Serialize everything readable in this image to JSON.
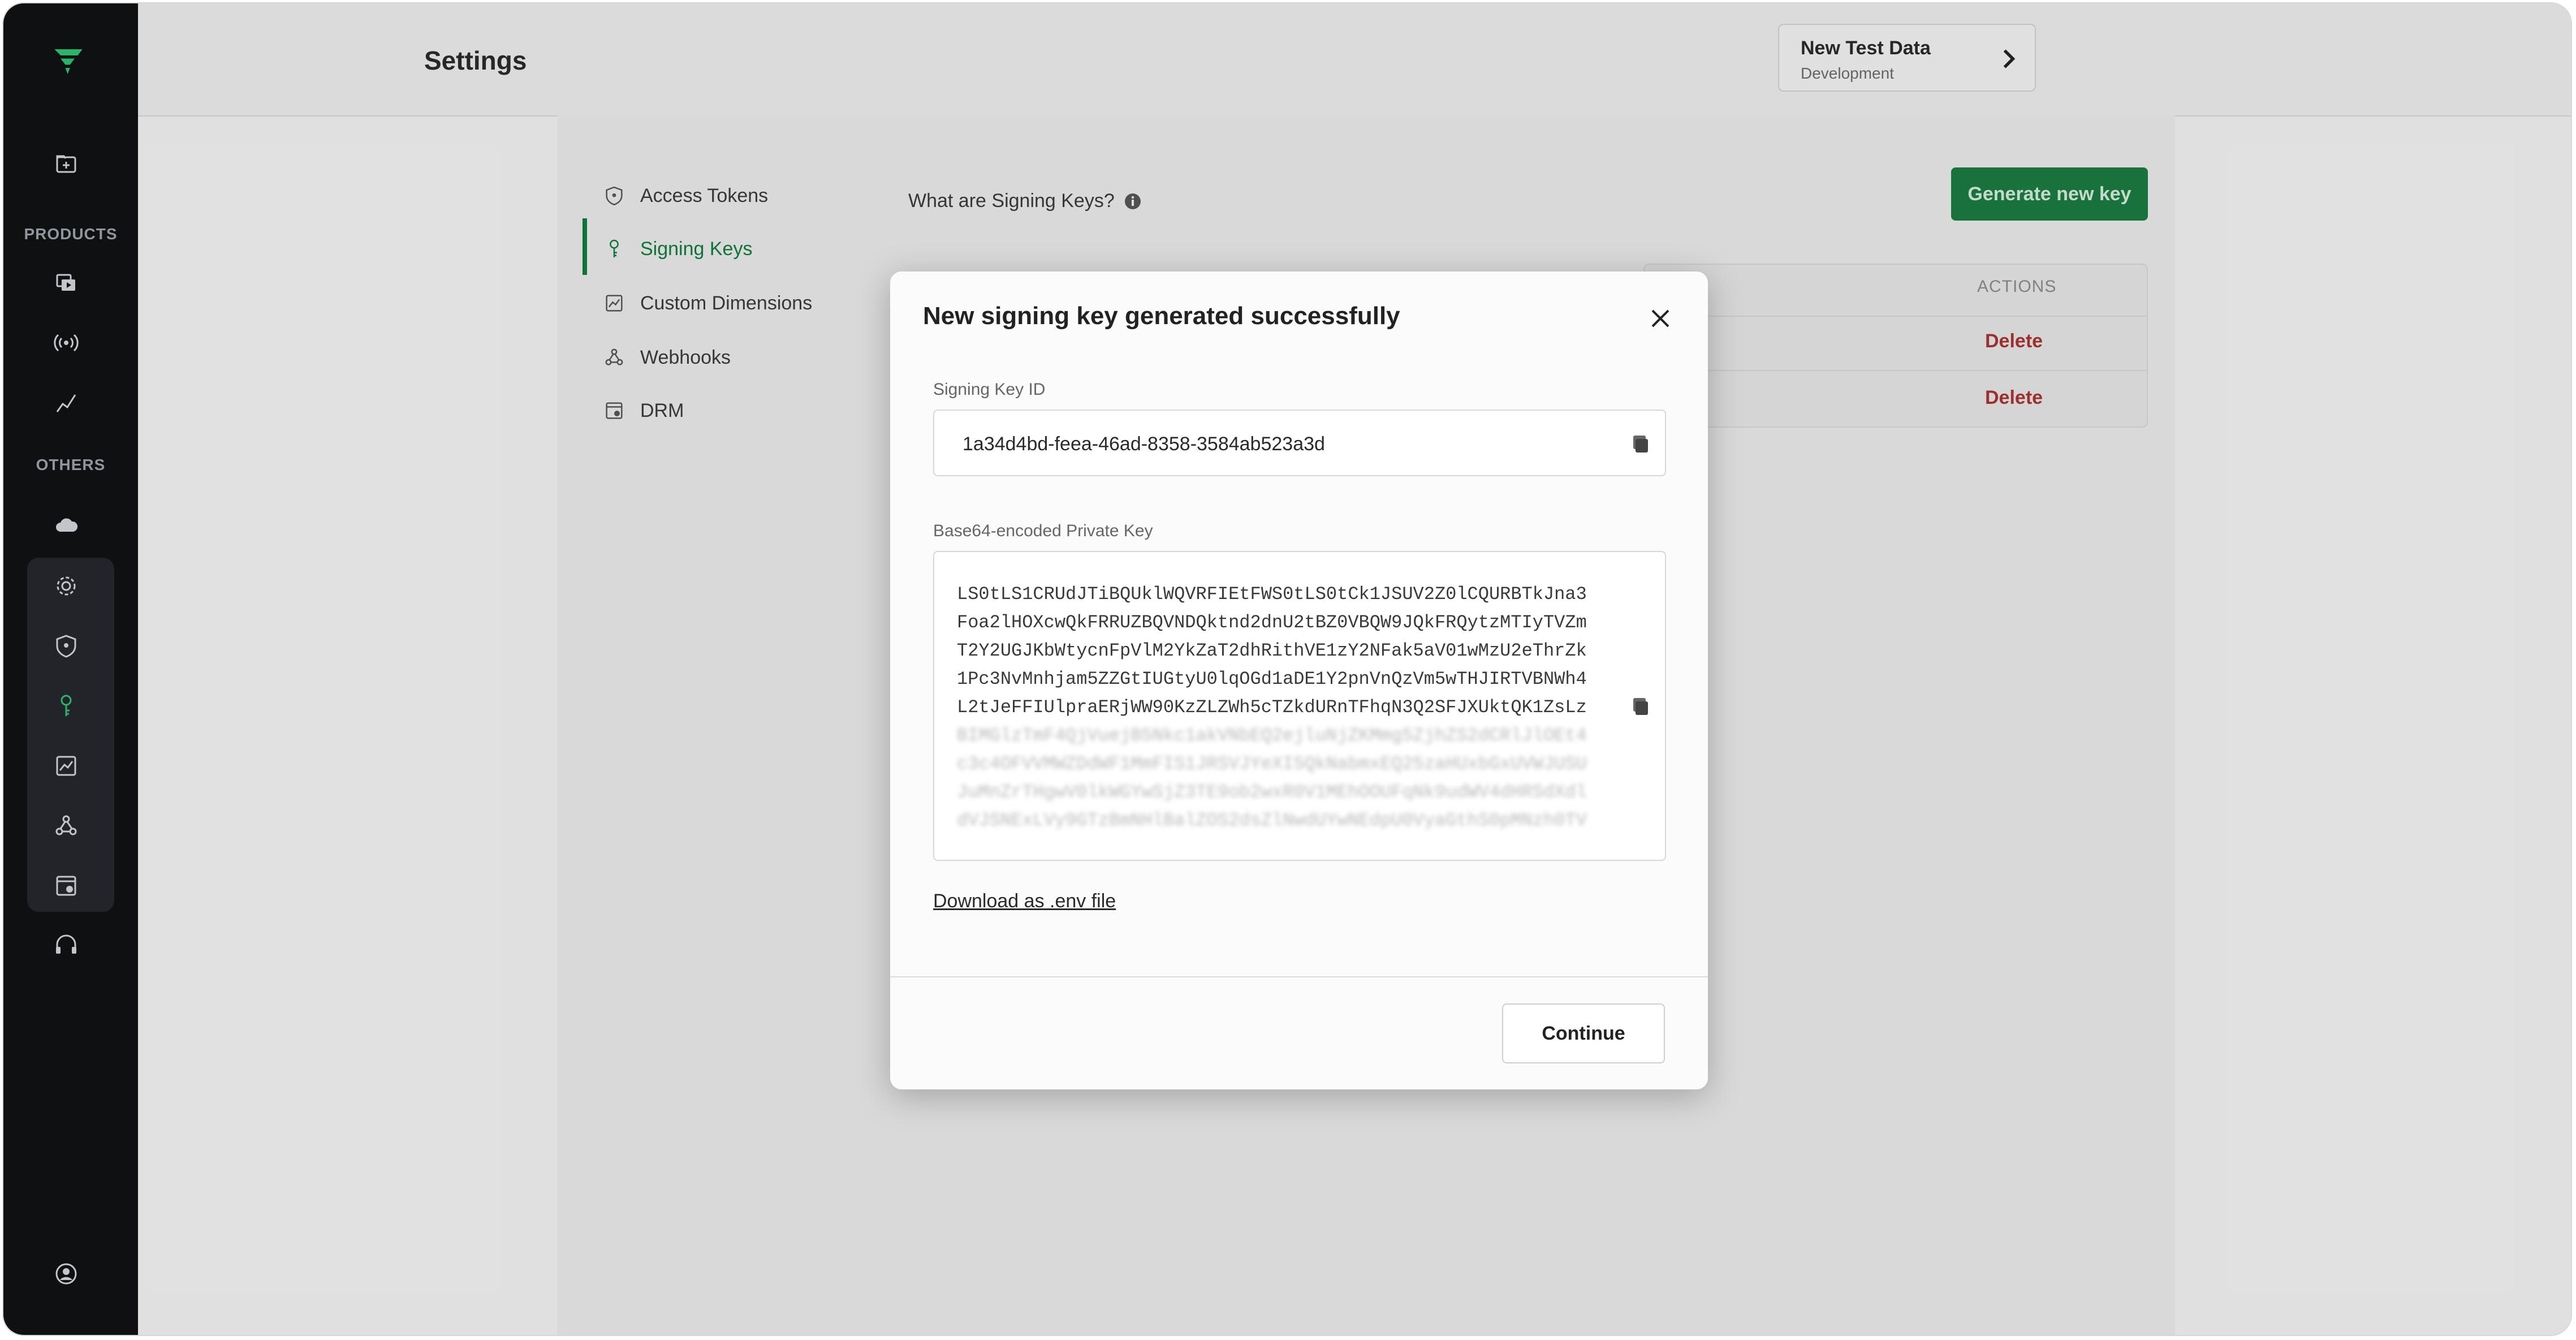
{
  "app": {
    "page_title": "Settings",
    "brand_color": "#107a3b"
  },
  "sidebar": {
    "section_products": "PRODUCTS",
    "section_others": "OTHERS",
    "icons": [
      "add-folder-icon",
      "video-icon",
      "live-stream-icon",
      "analytics-icon",
      "cloud-icon",
      "gear-icon",
      "shield-icon",
      "key-icon",
      "chart-icon",
      "webhook-icon",
      "drm-icon",
      "headset-icon",
      "user-icon"
    ]
  },
  "environment": {
    "name": "New Test Data",
    "type": "Development"
  },
  "settings_nav": {
    "items": [
      {
        "label": "Access Tokens",
        "icon": "shield-icon"
      },
      {
        "label": "Signing Keys",
        "icon": "key-icon",
        "active": true
      },
      {
        "label": "Custom Dimensions",
        "icon": "chart-icon"
      },
      {
        "label": "Webhooks",
        "icon": "webhook-icon"
      },
      {
        "label": "DRM",
        "icon": "drm-icon"
      }
    ]
  },
  "main": {
    "help_text": "What are Signing Keys?",
    "generate_button": "Generate new key",
    "table": {
      "actions_header": "ACTIONS",
      "rows": [
        {
          "action": "Delete"
        },
        {
          "action": "Delete"
        }
      ]
    }
  },
  "modal": {
    "title": "New signing key generated successfully",
    "signing_key_label": "Signing Key ID",
    "signing_key_id": "1a34d4bd-feea-46ad-8358-3584ab523a3d",
    "private_key_label": "Base64-encoded Private Key",
    "private_key_lines": [
      "LS0tLS1CRUdJTiBQUklWQVRFIEtFWS0tLS0tCk1JSUV2Z0lCQURBTkJna3",
      "Foa2lHOXcwQkFRRUZBQVNDQktnd2dnU2tBZ0VBQW9JQkFRQytzMTIyTVZm",
      "T2Y2UGJKbWtycnFpVlM2YkZaT2dhRithVE1zY2NFak5aV01wMzU2eThrZk",
      "1Pc3NvMnhjam5ZZGtIUGtyU0lqOGd1aDE1Y2pnVnQzVm5wTHJIRTVBNWh4",
      "L2tJeFFIUlpraERjWW90KzZLZWh5cTZkdURnTFhqN3Q2SFJXUktQK1ZsLz"
    ],
    "private_key_masked_lines": [
      "BIMGlzTmF4QjVuejB5Nkc1akVNbEQ2ejluNjZKMmg5ZjhZS2dCRlJlOEt4",
      "c3c4OFVVMWZDdWF1MmFIS1JRSVJYeXI5QkNabmxEQ25zaHUxbGxUVWJUSU",
      "JuMnZrTHgwV0lkWGYwSjZ3TE9ob2wxR0V1MEhOOUFqNk9udWV4dHRSdXdl",
      "dVJSNExLVy9GTzBmNHlBalZOS2dsZlNwdUYwNEdpU0VyaGthS0pMNzh0TV"
    ],
    "download_link": "Download as .env file",
    "continue_button": "Continue"
  }
}
